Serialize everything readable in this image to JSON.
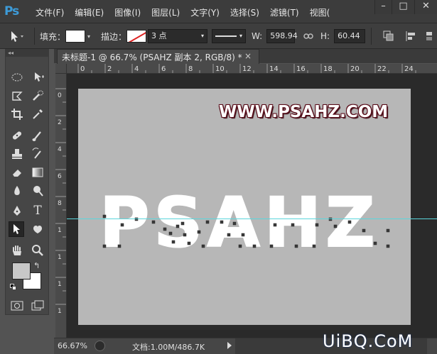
{
  "app": {
    "logo": "Ps",
    "menu": [
      "文件(F)",
      "编辑(E)",
      "图像(I)",
      "图层(L)",
      "文字(Y)",
      "选择(S)",
      "滤镜(T)",
      "视图("
    ],
    "window_controls": [
      "minimize",
      "maximize",
      "close"
    ]
  },
  "options": {
    "fill_label": "填充：",
    "stroke_label": "描边：",
    "stroke_width": "3 点",
    "w_label": "W:",
    "w_value": "598.94",
    "h_label": "H:",
    "h_value": "60.44  "
  },
  "document": {
    "tab_title": "未标题-1 @ 66.7% (PSAHZ 副本 2, RGB/8) *",
    "tab_close": "×",
    "ruler_top": [
      "0",
      "2",
      "4",
      "6",
      "8",
      "10",
      "12",
      "14",
      "16",
      "18",
      "20",
      "22",
      "24"
    ],
    "ruler_left": [
      "0",
      "2",
      "4",
      "6",
      "8",
      "1",
      "1",
      "1",
      "1"
    ],
    "canvas_text_main": "PSAHZ",
    "canvas_watermark": "WWW.PSAHZ.COM",
    "guide_color": "#5ad6dc",
    "canvas_color": "#b7b7b7"
  },
  "status": {
    "zoom": "66.67%",
    "doc_info": "文档:1.00M/486.7K"
  },
  "site_logo": "UiBQ.CoM",
  "toolbox": {
    "collapse": "◂◂",
    "tools": [
      "rectangular-marquee-icon",
      "move-icon",
      "lasso-icon",
      "quick-selection-icon",
      "crop-icon",
      "eyedropper-icon",
      "healing-brush-icon",
      "brush-icon",
      "clone-stamp-icon",
      "history-brush-icon",
      "eraser-icon",
      "gradient-icon",
      "blur-icon",
      "dodge-icon",
      "pen-icon",
      "type-icon",
      "direct-selection-icon",
      "custom-shape-icon",
      "hand-icon",
      "zoom-icon"
    ],
    "foreground_color": "#c8c8c8",
    "background_color": "#ffffff"
  }
}
